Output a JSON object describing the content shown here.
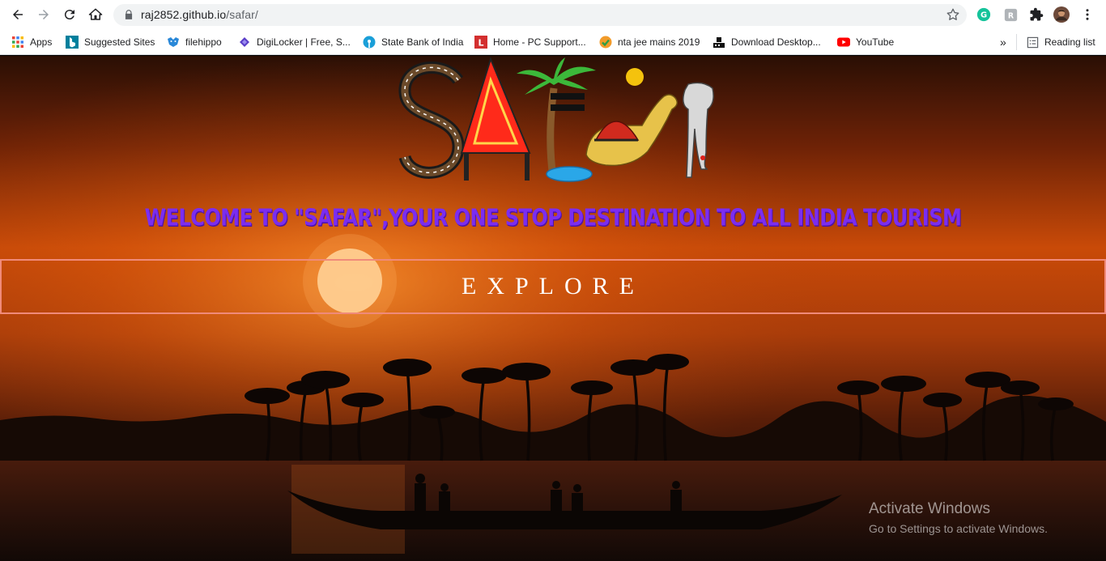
{
  "browser": {
    "url_host": "raj2852.github.io",
    "url_path": "/safar/",
    "icons": {
      "back": "arrow-left-icon",
      "forward": "arrow-right-icon",
      "reload": "reload-icon",
      "home": "home-icon",
      "lock": "lock-icon",
      "bookmark_star": "star-icon",
      "grammarly": "grammarly-icon",
      "extension_r": "extension-icon",
      "extensions": "puzzle-icon",
      "profile": "avatar",
      "menu": "kebab-menu-icon"
    },
    "bookmarks": [
      {
        "label": "Apps",
        "icon": "apps-grid-icon"
      },
      {
        "label": "Suggested Sites",
        "icon": "bing-icon"
      },
      {
        "label": "filehippo",
        "icon": "filehippo-icon"
      },
      {
        "label": "DigiLocker | Free, S...",
        "icon": "digilocker-icon"
      },
      {
        "label": "State Bank of India",
        "icon": "sbi-icon"
      },
      {
        "label": "Home - PC Support...",
        "icon": "pc-support-icon"
      },
      {
        "label": "nta jee mains 2019",
        "icon": "checkmark-icon"
      },
      {
        "label": "Download Desktop...",
        "icon": "download-icon"
      },
      {
        "label": "YouTube",
        "icon": "youtube-icon"
      }
    ],
    "overflow_label": "»",
    "reading_list_label": "Reading list"
  },
  "page": {
    "logo_name": "SAFAR",
    "welcome_text": "WELCOME TO \"SAFAR\",YOUR ONE STOP DESTINATION TO ALL INDIA TOURISM",
    "explore_label": "EXPLORE",
    "colors": {
      "welcome": "#7b2df0",
      "explore_border": "#f08a7a",
      "sky_top": "#2a0f05",
      "sky_mid": "#c94a08",
      "sun": "#ffd7a0"
    }
  },
  "windows_watermark": {
    "title": "Activate Windows",
    "subtitle": "Go to Settings to activate Windows."
  }
}
